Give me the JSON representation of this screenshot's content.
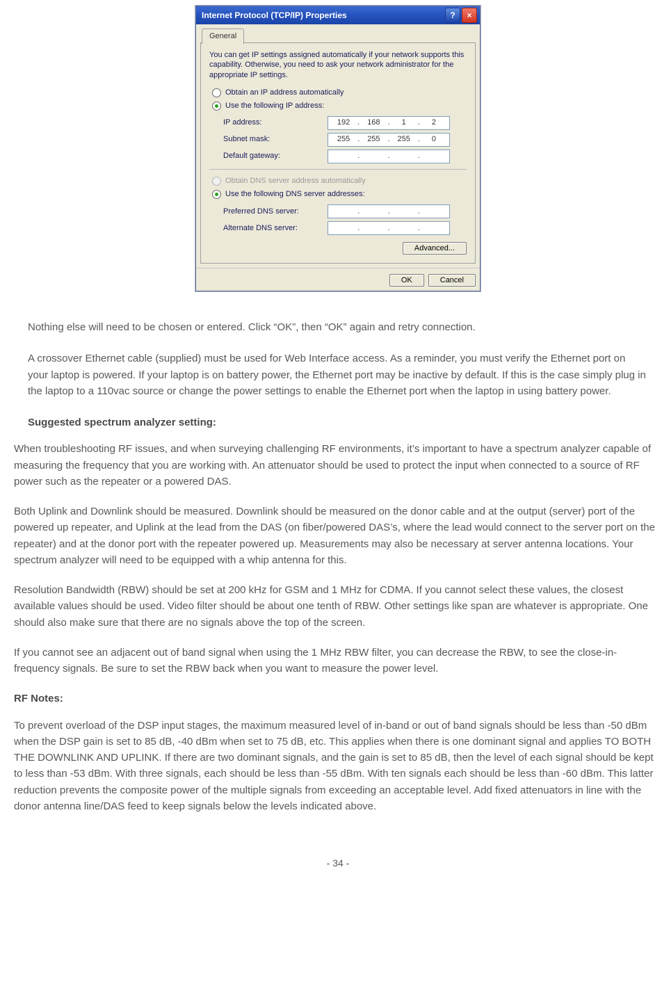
{
  "dialog": {
    "title": "Internet Protocol (TCP/IP) Properties",
    "help_symbol": "?",
    "close_symbol": "×",
    "tab_label": "General",
    "intro": "You can get IP settings assigned automatically if your network supports this capability. Otherwise, you need to ask your network administrator for the appropriate IP settings.",
    "radio_obtain_ip": "Obtain an IP address automatically",
    "radio_use_ip": "Use the following IP address:",
    "ip_label": "IP address:",
    "ip_value": [
      "192",
      "168",
      "1",
      "2"
    ],
    "subnet_label": "Subnet mask:",
    "subnet_value": [
      "255",
      "255",
      "255",
      "0"
    ],
    "gateway_label": "Default gateway:",
    "gateway_value": [
      "",
      "",
      "",
      ""
    ],
    "radio_obtain_dns": "Obtain DNS server address automatically",
    "radio_use_dns": "Use the following DNS server addresses:",
    "pref_dns_label": "Preferred DNS server:",
    "alt_dns_label": "Alternate DNS server:",
    "advanced_btn": "Advanced...",
    "ok_btn": "OK",
    "cancel_btn": "Cancel"
  },
  "body": {
    "p1": "Nothing else will need  to be chosen or entered. Click “OK”, then “OK” again and retry connection.",
    "p2": "A crossover Ethernet cable (supplied) must be used for Web Interface access.  As a reminder, you must verify the Ethernet port on your laptop is powered. If your laptop is on battery power, the Ethernet port may be inactive by default.  If this is the case simply plug in the laptop to a 110vac source or change the power settings to enable the Ethernet port when the laptop in using battery power.",
    "h1": "Suggested spectrum analyzer setting:",
    "p3": "When troubleshooting RF issues,  and when surveying challenging RF environments, it’s important to have a spectrum analyzer capable of measuring the frequency that you are working with.  An attenuator should be used to protect the input when connected to a source of RF power such as the repeater or a powered DAS.",
    "p4": "Both Uplink and Downlink should be measured.  Downlink should be measured on the donor cable and at the output (server) port of the powered up repeater, and Uplink at the lead from the DAS (on fiber/powered DAS’s, where the lead would connect to the server port on the repeater) and at the donor port with the repeater powered up.  Measurements may also be necessary at server antenna locations.  Your spectrum analyzer will need to be equipped with a whip antenna for this.",
    "p5": "Resolution Bandwidth (RBW) should be set at 200 kHz for GSM and 1 MHz for CDMA.  If you cannot select these values, the closest available values should be used.  Video filter should be about one tenth of RBW.  Other settings like span are whatever is appropriate.  One should also make sure that there are no signals above the top of the screen.",
    "p6": "If you cannot see an adjacent out of band signal when using the 1 MHz RBW filter, you can decrease the RBW, to see the close-in-frequency signals.  Be sure to set the RBW back when you want to measure the power level.",
    "h2": "RF Notes:",
    "p7": "To prevent overload of the DSP input stages, the maximum measured level of in-band or out of band signals should be less than -50 dBm when the DSP gain is set to 85 dB, -40 dBm when set to 75 dB, etc.  This applies when there is one dominant signal and applies TO BOTH THE DOWNLINK AND UPLINK.  If there are two dominant signals, and the gain is set to 85 dB, then the level of each signal should be kept to less than -53 dBm.  With three signals, each should be less than -55 dBm.  With ten signals each should be less than -60 dBm.  This latter reduction prevents the composite power of the multiple signals from exceeding an acceptable level.  Add fixed attenuators in line with the donor antenna line/DAS feed to keep signals below the levels indicated above.",
    "page_number": "- 34 -"
  }
}
